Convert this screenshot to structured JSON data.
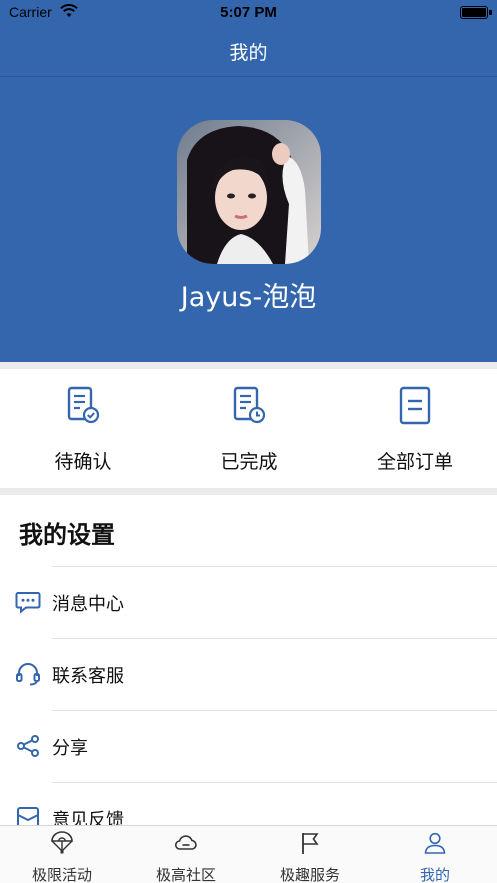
{
  "status_bar": {
    "carrier": "Carrier",
    "time": "5:07 PM",
    "battery_level": 1.0
  },
  "nav": {
    "title": "我的"
  },
  "profile": {
    "username": "Jayus-泡泡"
  },
  "orders": [
    {
      "label": "待确认",
      "icon": "document-check-icon"
    },
    {
      "label": "已完成",
      "icon": "document-clock-icon"
    },
    {
      "label": "全部订单",
      "icon": "document-list-icon"
    }
  ],
  "settings": {
    "title": "我的设置",
    "items": [
      {
        "label": "消息中心",
        "icon": "message-icon"
      },
      {
        "label": "联系客服",
        "icon": "headset-icon"
      },
      {
        "label": "分享",
        "icon": "share-icon"
      },
      {
        "label": "意见反馈",
        "icon": "feedback-icon"
      }
    ]
  },
  "tabbar": {
    "items": [
      {
        "label": "极限活动",
        "icon": "parachute-icon",
        "active": false
      },
      {
        "label": "极高社区",
        "icon": "cloud-icon",
        "active": false
      },
      {
        "label": "极趣服务",
        "icon": "flag-icon",
        "active": false
      },
      {
        "label": "我的",
        "icon": "user-icon",
        "active": true
      }
    ]
  },
  "colors": {
    "primary": "#3466ad",
    "background": "#ebebeb",
    "active_tab": "#3466ad"
  }
}
